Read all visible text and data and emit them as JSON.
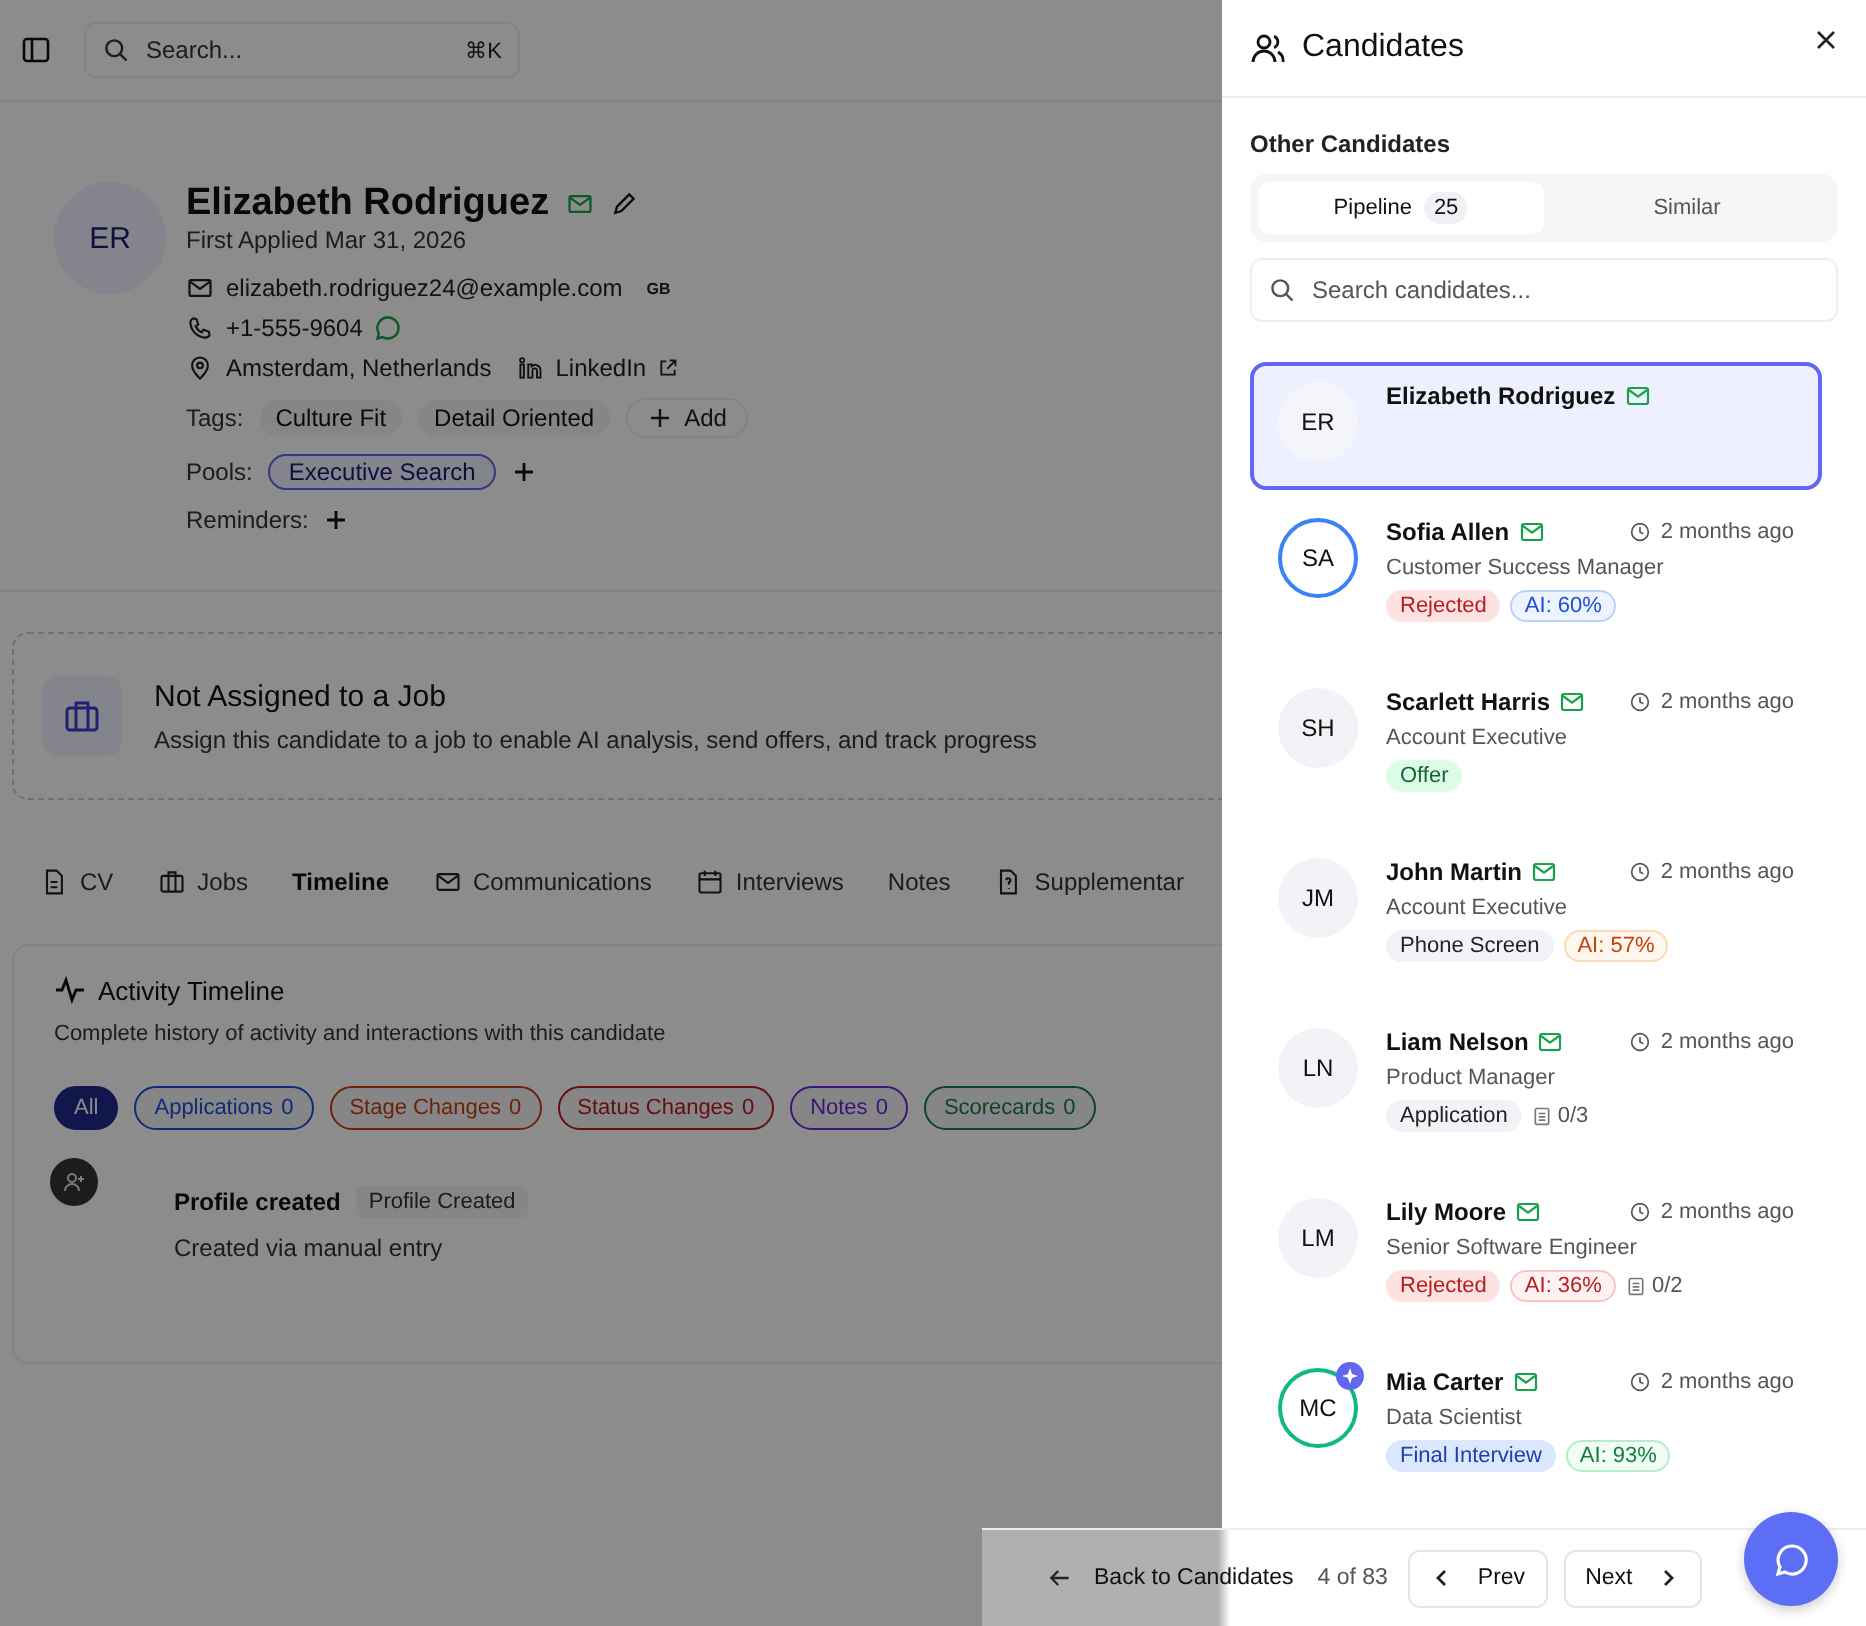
{
  "topbar": {
    "search_placeholder": "Search...",
    "shortcut": "⌘K"
  },
  "profile": {
    "initials": "ER",
    "name": "Elizabeth Rodriguez",
    "email_verified": true,
    "first_applied": "First Applied Mar 31, 2026",
    "email": "elizabeth.rodriguez24@example.com",
    "email_badge": "GB",
    "phone": "+1-555-9604",
    "location": "Amsterdam, Netherlands",
    "linkedin": "LinkedIn",
    "tags_label": "Tags:",
    "tags": [
      "Culture Fit",
      "Detail Oriented"
    ],
    "add_tag": "Add",
    "pools_label": "Pools:",
    "pools": [
      "Executive Search"
    ],
    "reminders_label": "Reminders:"
  },
  "job_card": {
    "title": "Not Assigned to a Job",
    "text": "Assign this candidate to a job to enable AI analysis, send offers, and track progress"
  },
  "tabs": [
    {
      "label": "CV",
      "selected": false
    },
    {
      "label": "Jobs",
      "selected": false
    },
    {
      "label": "Timeline",
      "selected": true
    },
    {
      "label": "Communications",
      "selected": false
    },
    {
      "label": "Interviews",
      "selected": false
    },
    {
      "label": "Notes",
      "selected": false
    },
    {
      "label": "Supplementar",
      "selected": false
    }
  ],
  "timeline": {
    "title": "Activity Timeline",
    "subtitle": "Complete history of activity and interactions with this candidate",
    "filters": [
      {
        "label": "All",
        "selected": true,
        "color": "#11174c"
      },
      {
        "label": "Applications",
        "count": "0",
        "selected": false,
        "color": "#102b77"
      },
      {
        "label": "Stage Changes",
        "count": "0",
        "selected": false,
        "color": "#6b2407"
      },
      {
        "label": "Status Changes",
        "count": "0",
        "selected": false,
        "color": "#660f0f"
      },
      {
        "label": "Notes",
        "count": "0",
        "selected": false,
        "color": "#3c1677"
      },
      {
        "label": "Scorecards",
        "count": "0",
        "selected": false,
        "color": "#0c4622"
      }
    ],
    "events": [
      {
        "title": "Profile created",
        "tag": "Profile Created",
        "detail": "Created via manual entry"
      }
    ]
  },
  "drawer": {
    "title": "Candidates",
    "section": "Other Candidates",
    "tabs": [
      {
        "label": "Pipeline",
        "count": "25",
        "selected": true
      },
      {
        "label": "Similar",
        "selected": false
      }
    ],
    "search_placeholder": "Search candidates...",
    "candidates": [
      {
        "initials": "ER",
        "name": "Elizabeth Rodriguez",
        "verified": true,
        "selected": true,
        "ai_badge": false
      },
      {
        "initials": "SA",
        "name": "Sofia Allen",
        "verified": true,
        "time": "2 months ago",
        "role": "Customer Success Manager",
        "selected": false,
        "color": "#3b82f6",
        "ai_badge": false,
        "badges": [
          {
            "text": "Rejected",
            "kind": "stage-red"
          },
          {
            "text": "AI: 60%",
            "kind": "score-blue"
          }
        ]
      },
      {
        "initials": "SH",
        "name": "Scarlett Harris",
        "verified": true,
        "time": "2 months ago",
        "role": "Account Executive",
        "selected": false,
        "ai_badge": false,
        "badges": [
          {
            "text": "Offer",
            "kind": "stage-green"
          }
        ]
      },
      {
        "initials": "JM",
        "name": "John Martin",
        "verified": true,
        "time": "2 months ago",
        "role": "Account Executive",
        "selected": false,
        "ai_badge": false,
        "badges": [
          {
            "text": "Phone Screen",
            "kind": "stage-gray"
          },
          {
            "text": "AI: 57%",
            "kind": "score-orange"
          }
        ]
      },
      {
        "initials": "LN",
        "name": "Liam Nelson",
        "verified": true,
        "time": "2 months ago",
        "role": "Product Manager",
        "selected": false,
        "ai_badge": false,
        "badges": [
          {
            "text": "Application",
            "kind": "stage-gray"
          }
        ],
        "scorecards": "0/3"
      },
      {
        "initials": "LM",
        "name": "Lily Moore",
        "verified": true,
        "time": "2 months ago",
        "role": "Senior Software Engineer",
        "selected": false,
        "ai_badge": false,
        "badges": [
          {
            "text": "Rejected",
            "kind": "stage-red"
          },
          {
            "text": "AI: 36%",
            "kind": "score-red"
          }
        ],
        "scorecards": "0/2"
      },
      {
        "initials": "MC",
        "name": "Mia Carter",
        "verified": true,
        "time": "2 months ago",
        "role": "Data Scientist",
        "selected": false,
        "color": "#10b981",
        "ai_badge": true,
        "badges": [
          {
            "text": "Final Interview",
            "kind": "stage-blue"
          },
          {
            "text": "AI: 93%",
            "kind": "score-green"
          }
        ]
      }
    ]
  },
  "footer": {
    "back": "Back to Candidates",
    "position": "4 of 83",
    "prev": "Prev",
    "next": "Next"
  }
}
